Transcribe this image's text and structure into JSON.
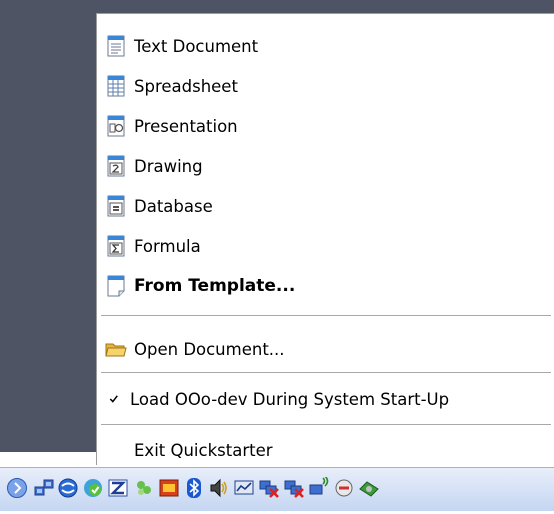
{
  "menu": {
    "items": [
      {
        "label": "Text Document",
        "icon": "text-document-icon"
      },
      {
        "label": "Spreadsheet",
        "icon": "spreadsheet-icon"
      },
      {
        "label": "Presentation",
        "icon": "presentation-icon"
      },
      {
        "label": "Drawing",
        "icon": "drawing-icon"
      },
      {
        "label": "Database",
        "icon": "database-icon"
      },
      {
        "label": "Formula",
        "icon": "formula-icon"
      },
      {
        "label": "From Template...",
        "icon": "template-icon"
      }
    ],
    "open_document": {
      "label": "Open Document...",
      "icon": "folder-icon"
    },
    "load_at_startup": {
      "label": "Load OOo-dev During System Start-Up",
      "checked": true,
      "icon": "checkmark-icon"
    },
    "exit": {
      "label": "Exit Quickstarter"
    }
  },
  "taskbar": {
    "tray_icons": [
      "expand-tray-icon",
      "network-icon",
      "sync-icon",
      "security-icon",
      "tool-icon",
      "messenger-icon",
      "music-icon",
      "bluetooth-icon",
      "volume-icon",
      "monitor-icon",
      "network-disconnected-icon",
      "network-disconnected-icon",
      "wireless-icon",
      "quickstarter-icon",
      "update-icon"
    ]
  }
}
